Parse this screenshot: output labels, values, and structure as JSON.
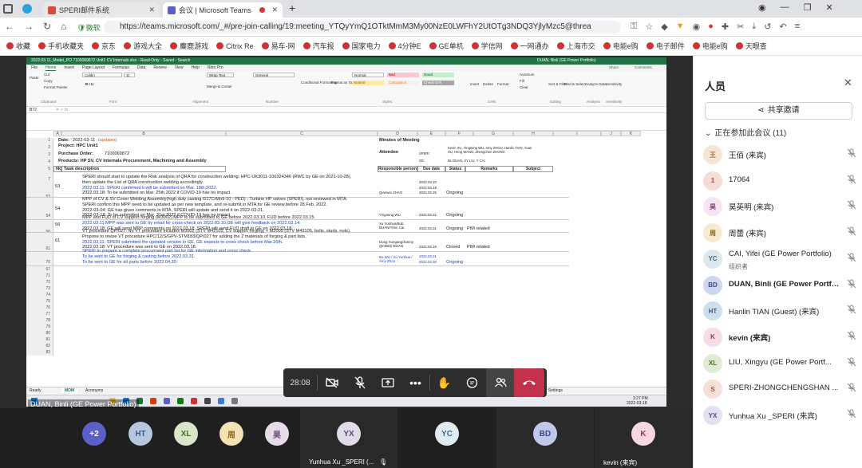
{
  "browser": {
    "tabs": [
      {
        "label": "SPERI邮件系统",
        "active": false
      },
      {
        "label": "会议 | Microsoft Teams",
        "active": true
      }
    ],
    "new_tab": "+",
    "badge": "微软",
    "url": "https://teams.microsoft.com/_#/pre-join-calling/19:meeting_YTQyYmQ1OTktMmM3My00NzE0LWFhY2UtOTg3NDQ3YjlyMzc5@threa",
    "bookmarks": [
      "收藏",
      "手机收藏夹",
      "京东",
      "游戏大全",
      "麋鹿游戏",
      "Citrix Re",
      "易车-网",
      "汽车报",
      "国家电力",
      "4分钟E",
      "GE单机",
      "学信网",
      "一网通办",
      "上海市交",
      "电能e购",
      "电子邮件",
      "电能e购",
      "天眼查"
    ]
  },
  "excel": {
    "title_bar": "2022.03.11_Model_PO 7100069872 Unit1 CV Internals.xlsx - Read-Only - Saved - Search",
    "user": "DUAN, Binli (GE Power Portfolio)",
    "ribbon_tabs": [
      "File",
      "Home",
      "Insert",
      "Page Layout",
      "Formulas",
      "Data",
      "Review",
      "View",
      "Help",
      "Nitro Pro"
    ],
    "ribbon_buttons": {
      "paste": "Paste",
      "cut": "Cut",
      "copy": "Copy",
      "format_painter": "Format Painter",
      "font": "Calibri",
      "size": "11",
      "wrap": "Wrap Text",
      "merge": "Merge & Center",
      "general": "General",
      "cond": "Conditional Formatting",
      "fmt_table": "Format as Table",
      "normal": "Normal",
      "bad": "Bad",
      "good": "Good",
      "neutral": "Neutral",
      "calc": "Calculation",
      "check": "Check Cell",
      "insert": "Insert",
      "delete": "Delete",
      "format": "Format",
      "autosum": "AutoSum",
      "fill": "Fill",
      "clear": "Clear",
      "sort": "Sort & Filter",
      "find": "Find & Select",
      "analyze": "Analyze Data",
      "sensitivity": "Sensitivity",
      "share": "Share",
      "comments": "Comments",
      "grp_clipboard": "Clipboard",
      "grp_font": "Font",
      "grp_alignment": "Alignment",
      "grp_number": "Number",
      "grp_styles": "Styles",
      "grp_cells": "Cells",
      "grp_editing": "Editing",
      "grp_analysis": "Analysis",
      "grp_sensitivity": "Sensitivity"
    },
    "name_box": "B72",
    "columns": [
      "A",
      "B",
      "C",
      "D",
      "E",
      "F",
      "G",
      "H",
      "I",
      "J",
      "K"
    ],
    "header": {
      "date_label": "Date:",
      "date_value": "2022-03-11",
      "date_note": "(updates)",
      "project": "Project: HPC Unit1",
      "po_label": "Purchase Order:",
      "po_value": "7100069872",
      "products": "Products: HP SV, CV Internals Procurement, Machining and Assembly",
      "minutes": "Minutes of Meeting",
      "attendee": "Attendee",
      "speri_label": "SPERI:",
      "speri_names": "Kevin XU, Yingming WU, Amy ZHOU, Hanlin TIAN, Yuan XU, Heng WANG, Zhengchen ZHONG",
      "ge_label": "GE:",
      "ge_names": "BL DUAN, XY LIU, Y CAI"
    },
    "table_headers": [
      "No",
      "Task description",
      "Responsible person",
      "Due date",
      "Status",
      "Remarks",
      "Subject"
    ],
    "row_numbers": [
      "1",
      "2",
      "3",
      "4",
      "5",
      "7",
      "53",
      "54",
      "56",
      "61",
      "70",
      "67",
      "71",
      "72",
      "73",
      "74",
      "75",
      "76",
      "77",
      "78",
      "79",
      "80",
      "81",
      "82",
      "83"
    ],
    "rows": [
      {
        "no": "53",
        "lines": [
          {
            "t": "SPERI should start to update the Risk analysis of QRA for construction welding: HPC-UK3011-100324346 (RWC by GE on 2021-10-28),",
            "c": ""
          },
          {
            "t": "then update the List of QRA construction welding accordingly.",
            "c": ""
          },
          {
            "t": "2022.03.11: SPERI confirmed it will be submitted on Mar. 18th,2022.",
            "c": "blue"
          },
          {
            "t": "2022.03.18: To be submitted on Mar. 25th,2022 if COVID-19 has no impact.",
            "c": ""
          }
        ],
        "resp": "Qianwei ZHAO",
        "due": [
          "2022.03.10",
          "2022.03.18",
          "2022.03.25"
        ],
        "status": "Ongoing",
        "remarks": ""
      },
      {
        "no": "54",
        "lines": [
          {
            "t": "MPP of CV & SV Cover Welding Assembly(high duty casting G17CrMo9-10 - PED) - Turbine HP valves (SPERI), not reviewed in MTA.",
            "c": ""
          },
          {
            "t": "SPERI confirm this MPP need to be updated as per new template, and re-submit in MTA for GE review before 28 Feb. 2022.",
            "c": ""
          },
          {
            "t": "2022-03-04: GE has given comments in MTA. SPERI will update and send it on 2022-03-21.",
            "c": ""
          },
          {
            "t": "2022-03-18: To be submitted on Mar. 31st,2022 if COVID-19 has no impact.",
            "c": ""
          }
        ],
        "resp": "Yingming WU",
        "due": [
          "2022.03.21"
        ],
        "status": "Ongoing",
        "remarks": ""
      },
      {
        "no": "56",
        "lines": [
          {
            "t": "MPP and FUD of CV support forging (M3002).MPP to be submitted to GE before 2022.03.10. FUD before 2022.03.15.",
            "c": ""
          },
          {
            "t": "2022.03.11:MPP was sent to GE by email for cross-check on 2022.03.10.GE will give feedback on 2022.03.14.",
            "c": "blue"
          },
          {
            "t": "2022.03.18: GE will send MPP comments on 2022.03.18. SPERI will send FUD draft to GE on 2022.03.18.",
            "c": ""
          }
        ],
        "resp": "Xu Yunhua/Bob DUAN/Yifen Cai",
        "due": [
          "2022.03.31"
        ],
        "status": "Ongoing",
        "remarks": "PIM related"
      },
      {
        "no": "61",
        "lines": [
          {
            "t": "VT procedure QP/027: No VT procedure includes M3002 (STV M42102, CV support forging) + M2005 (STV M43105, bolts, studs, nuts).",
            "c": ""
          },
          {
            "t": "Propose to revise VT procedure HPC/12/S/GPV-STM183/QP/027 for adding the 2 materials of forging & part lists.",
            "c": ""
          },
          {
            "t": "2022.03.11: SPERI submitted the updated version to GE. GE expects to cross check before Mar.16th.",
            "c": "blue"
          },
          {
            "t": "2022.03.18: VT procedure was sent to GE on 2022.03.18.",
            "c": ""
          }
        ],
        "resp": "Dong Xuegang/Sanny Qin/Binli DUAN",
        "due": [
          "2022.03.16"
        ],
        "status": "Closed",
        "remarks": "PIM related"
      },
      {
        "no": "",
        "lines": [
          {
            "t": "SPERI to prepare a complete procurment part list for GE information and cross check.",
            "c": "blue"
          },
          {
            "t": "To be sent to GE for forging & casting before 2022.03.31.",
            "c": "blue"
          },
          {
            "t": "To be sent to GE for all parts before 2022.04.30.",
            "c": "blue"
          }
        ],
        "resp": "Bo WU / Xu Yunhua / Amy Zhou",
        "due": [
          "2022.03.31",
          "2022.04.30"
        ],
        "status": "Ongoing",
        "remarks": ""
      }
    ],
    "sheet_tabs": [
      "MOM",
      "Acronyms"
    ],
    "status_left": "Ready",
    "status_right": "Display Settings",
    "clock_time": "3:27 PM",
    "clock_date": "2022-03-18"
  },
  "presenter": "DUAN, Binli (GE Power Portfolio)",
  "controls": {
    "timer": "28:08"
  },
  "strip": [
    {
      "initials": "+2",
      "bg": "#5b5fc7",
      "fg": "#ffffff"
    },
    {
      "initials": "HT",
      "bg": "#b8c7e0",
      "fg": "#3d5a8a"
    },
    {
      "initials": "XL",
      "bg": "#d8e5c8",
      "fg": "#4d6b2a"
    },
    {
      "initials": "周",
      "bg": "#f3e3b4",
      "fg": "#8a6a1a"
    },
    {
      "initials": "昊",
      "bg": "#e6dce8",
      "fg": "#6b4a7a"
    },
    {
      "initials": "YX",
      "bg": "#e1dbe8",
      "fg": "#5a4a7a",
      "label": "Yunhua Xu _SPERI (..."
    },
    {
      "initials": "YC",
      "bg": "#dfeaf2",
      "fg": "#4a6a8a"
    },
    {
      "initials": "BD",
      "bg": "#bfc8e6",
      "fg": "#3d4a8a"
    },
    {
      "initials": "K",
      "bg": "#f6d7e3",
      "fg": "#a0385a",
      "label": "kevin (来宾)"
    }
  ],
  "panel": {
    "title": "人员",
    "invite": "共享邀请",
    "in_meeting": "正在参加此会议 (11)",
    "people": [
      {
        "initials": "王",
        "name": "王佰 (来宾)",
        "bg": "#f6e5d2",
        "fg": "#9a6a3a",
        "bold": false,
        "sub": ""
      },
      {
        "initials": "1",
        "name": "17064",
        "bg": "#f7dcd6",
        "fg": "#a0483a",
        "bold": false,
        "sub": ""
      },
      {
        "initials": "昊",
        "name": "昊英明 (来宾)",
        "bg": "#f3e6f2",
        "fg": "#8a4a7a",
        "bold": false,
        "sub": ""
      },
      {
        "initials": "周",
        "name": "周蕾 (来宾)",
        "bg": "#f6ebcf",
        "fg": "#8a6a1a",
        "bold": false,
        "sub": ""
      },
      {
        "initials": "YC",
        "name": "CAI, Yifei (GE Power Portfolio)",
        "bg": "#dbe9ee",
        "fg": "#3a6a7a",
        "bold": false,
        "sub": "组织者"
      },
      {
        "initials": "BD",
        "name": "DUAN, Binli (GE Power Portfolio)",
        "bg": "#cfd7ef",
        "fg": "#3a4a8a",
        "bold": true,
        "sub": ""
      },
      {
        "initials": "HT",
        "name": "Hanlin TIAN (Guest) (来宾)",
        "bg": "#cfe0ec",
        "fg": "#3a5a7a",
        "bold": false,
        "sub": ""
      },
      {
        "initials": "K",
        "name": "kevin (来宾)",
        "bg": "#f7dbe5",
        "fg": "#a0385a",
        "bold": true,
        "sub": ""
      },
      {
        "initials": "XL",
        "name": "LIU, Xingyu (GE Power Portf...",
        "bg": "#dfebd2",
        "fg": "#4d6b2a",
        "bold": false,
        "sub": ""
      },
      {
        "initials": "S",
        "name": "SPERI-ZHONGCHENGSHAN ...",
        "bg": "#f6dfd6",
        "fg": "#a0583a",
        "bold": false,
        "sub": ""
      },
      {
        "initials": "YX",
        "name": "Yunhua Xu _SPERI (来宾)",
        "bg": "#e4e0ef",
        "fg": "#5a4a8a",
        "bold": false,
        "sub": ""
      }
    ]
  }
}
